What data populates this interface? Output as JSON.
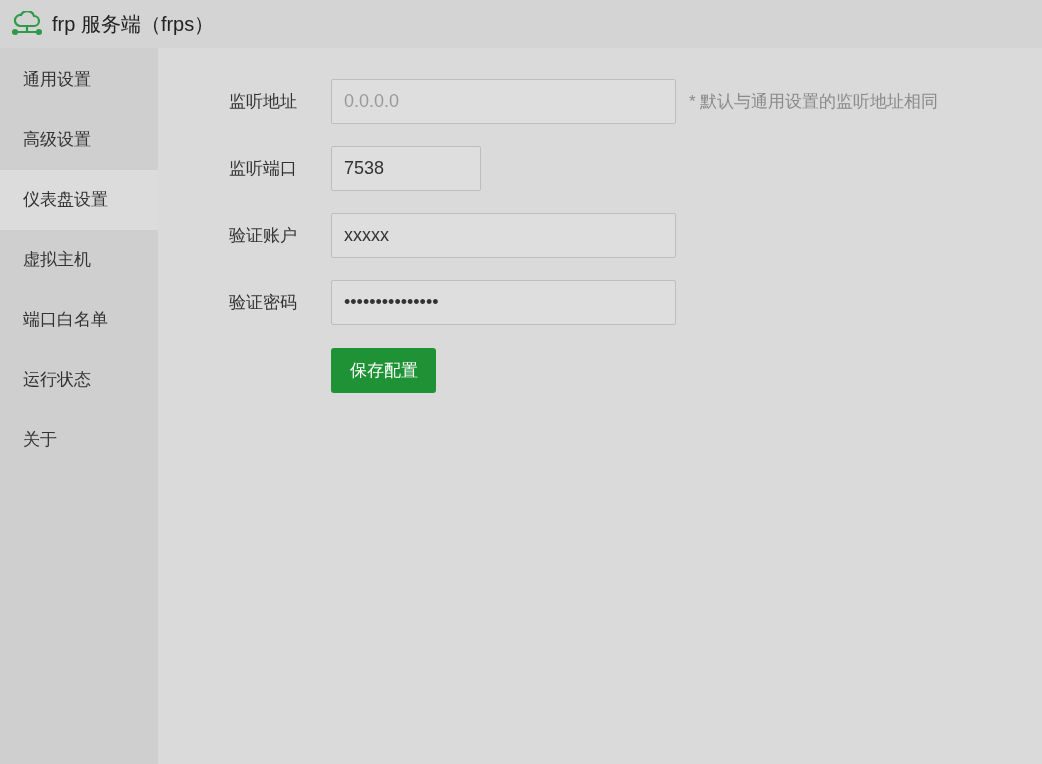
{
  "window": {
    "title": "frp 服务端（frps）"
  },
  "sidebar": {
    "items": [
      {
        "label": "通用设置",
        "selected": false
      },
      {
        "label": "高级设置",
        "selected": false
      },
      {
        "label": "仪表盘设置",
        "selected": true
      },
      {
        "label": "虚拟主机",
        "selected": false
      },
      {
        "label": "端口白名单",
        "selected": false
      },
      {
        "label": "运行状态",
        "selected": false
      },
      {
        "label": "关于",
        "selected": false
      }
    ]
  },
  "form": {
    "fields": [
      {
        "label": "监听地址",
        "placeholder": "0.0.0.0",
        "hint": "* 默认与通用设置的监听地址相同",
        "kind": "address"
      },
      {
        "label": "监听端口",
        "value": "7538",
        "kind": "port"
      },
      {
        "label": "验证账户",
        "value": "xxxxx",
        "kind": "text"
      },
      {
        "label": "验证密码",
        "value": "•••••••••••••••",
        "kind": "password"
      }
    ],
    "save_button": "保存配置"
  }
}
